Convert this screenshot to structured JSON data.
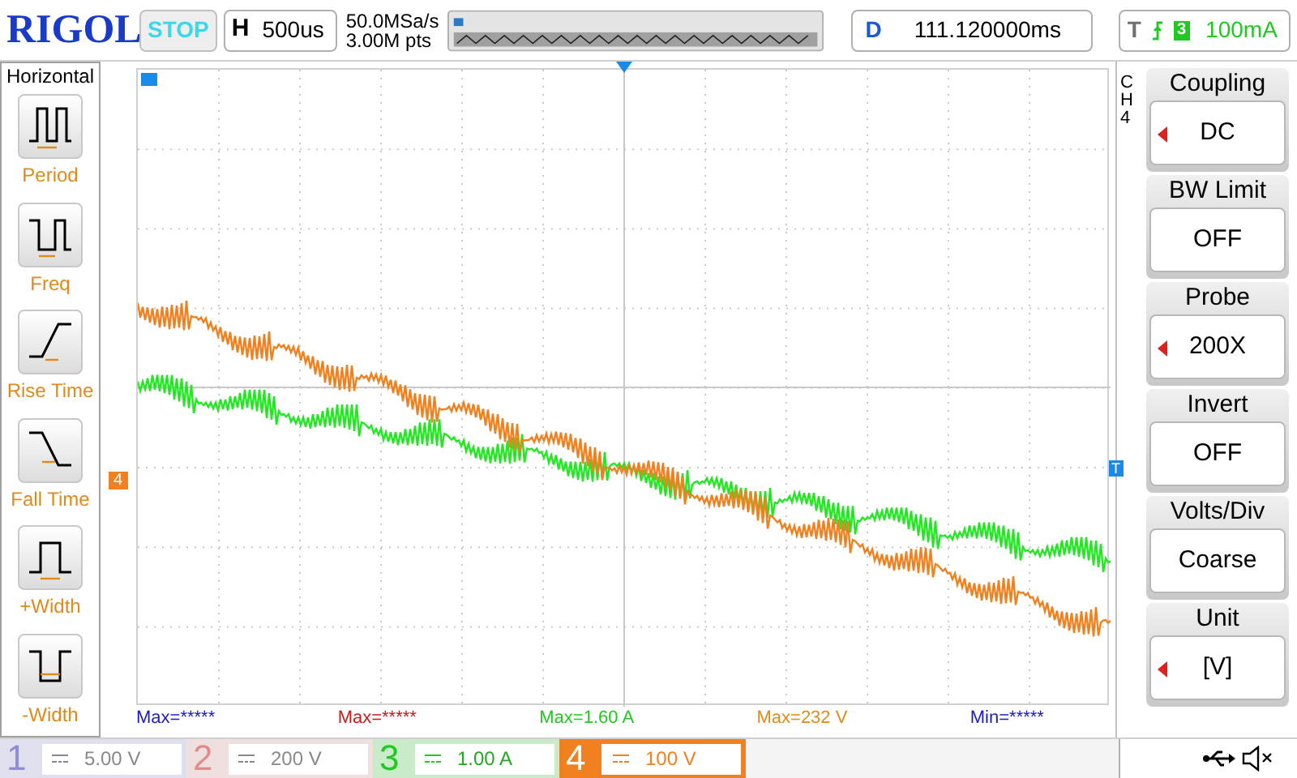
{
  "brand": "RIGOL",
  "run_state": "STOP",
  "timebase": {
    "label": "H",
    "value": "500us"
  },
  "sample_rate": "50.0MSa/s",
  "memory_depth": "3.00M pts",
  "delay": {
    "label": "D",
    "value": "111.120000ms"
  },
  "trigger": {
    "label": "T",
    "source": "3",
    "level": "100mA"
  },
  "measure_menu": {
    "title": "Horizontal",
    "items": [
      {
        "label": "Period",
        "kind": "period"
      },
      {
        "label": "Freq",
        "kind": "freq"
      },
      {
        "label": "Rise Time",
        "kind": "rise"
      },
      {
        "label": "Fall Time",
        "kind": "fall"
      },
      {
        "label": "+Width",
        "kind": "pwidth"
      },
      {
        "label": "-Width",
        "kind": "nwidth"
      }
    ]
  },
  "channel_menu": {
    "channel": "CH4",
    "items": [
      {
        "title": "Coupling",
        "value": "DC",
        "adjustable": true
      },
      {
        "title": "BW Limit",
        "value": "OFF",
        "adjustable": false
      },
      {
        "title": "Probe",
        "value": "200X",
        "adjustable": true
      },
      {
        "title": "Invert",
        "value": "OFF",
        "adjustable": false
      },
      {
        "title": "Volts/Div",
        "value": "Coarse",
        "adjustable": false
      },
      {
        "title": "Unit",
        "value": "[V]",
        "adjustable": true
      }
    ]
  },
  "offset_marker": "4",
  "trigger_level_marker": "T",
  "measurements": [
    {
      "text": "Max=*****",
      "color": "#1a1ac8"
    },
    {
      "text": "Max=*****",
      "color": "#c81a1a"
    },
    {
      "text": "Max=1.60 A",
      "color": "#22c822"
    },
    {
      "text": "Max=232 V",
      "color": "#e08a1a"
    },
    {
      "text": "Min=*****",
      "color": "#1a1ac8"
    }
  ],
  "channels": [
    {
      "number": "1",
      "scale": "5.00 V",
      "enabled": false,
      "selected": false,
      "color": "#8c8cd8"
    },
    {
      "number": "2",
      "scale": "200 V",
      "enabled": false,
      "selected": false,
      "color": "#e08c8c"
    },
    {
      "number": "3",
      "scale": "1.00 A",
      "enabled": true,
      "selected": false,
      "color": "#22c822"
    },
    {
      "number": "4",
      "scale": "100 V",
      "enabled": true,
      "selected": true,
      "color": "#f08020"
    }
  ]
}
